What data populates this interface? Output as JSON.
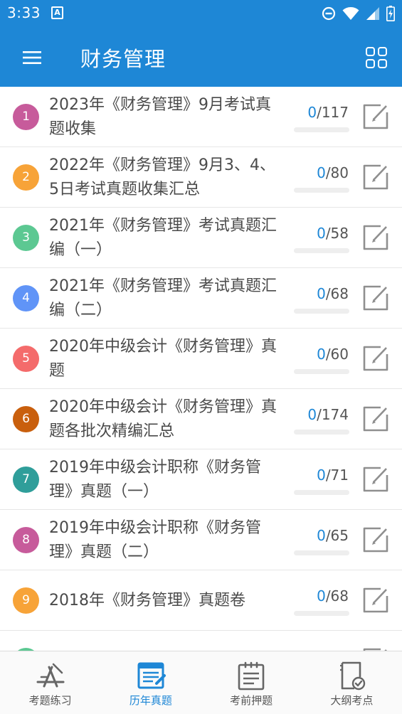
{
  "status": {
    "time": "3:33",
    "notification_glyph": "A"
  },
  "header": {
    "title": "财务管理",
    "menu_icon": "hamburger-menu-icon",
    "grid_icon": "grid-view-icon"
  },
  "colors": {
    "primary": "#1e87d6",
    "badges": [
      "#c75b9b",
      "#f7a338",
      "#5cc892",
      "#6094f7",
      "#f46b6b",
      "#c95f0d",
      "#2f9e9a",
      "#c75b9b",
      "#f7a338",
      "#5cc892"
    ]
  },
  "papers": [
    {
      "index": "1",
      "title": "2023年《财务管理》9月考试真题收集",
      "done": "0",
      "total": "/117",
      "progress": 0
    },
    {
      "index": "2",
      "title": "2022年《财务管理》9月3、4、5日考试真题收集汇总",
      "done": "0",
      "total": "/80",
      "progress": 0
    },
    {
      "index": "3",
      "title": "2021年《财务管理》考试真题汇编（一）",
      "done": "0",
      "total": "/58",
      "progress": 0
    },
    {
      "index": "4",
      "title": "2021年《财务管理》考试真题汇编（二）",
      "done": "0",
      "total": "/68",
      "progress": 0
    },
    {
      "index": "5",
      "title": "2020年中级会计《财务管理》真题",
      "done": "0",
      "total": "/60",
      "progress": 0
    },
    {
      "index": "6",
      "title": "2020年中级会计《财务管理》真题各批次精编汇总",
      "done": "0",
      "total": "/174",
      "progress": 0
    },
    {
      "index": "7",
      "title": "2019年中级会计职称《财务管理》真题（一）",
      "done": "0",
      "total": "/71",
      "progress": 0
    },
    {
      "index": "8",
      "title": "2019年中级会计职称《财务管理》真题（二）",
      "done": "0",
      "total": "/65",
      "progress": 0
    },
    {
      "index": "9",
      "title": "2018年《财务管理》真题卷",
      "done": "0",
      "total": "/68",
      "progress": 0
    },
    {
      "index": "",
      "title": "",
      "done": "",
      "total": "",
      "progress": 0
    }
  ],
  "tabs": [
    {
      "label": "考题练习",
      "icon": "practice-icon",
      "active": false
    },
    {
      "label": "历年真题",
      "icon": "past-papers-icon",
      "active": true
    },
    {
      "label": "考前押题",
      "icon": "prediction-icon",
      "active": false
    },
    {
      "label": "大纲考点",
      "icon": "syllabus-icon",
      "active": false
    }
  ]
}
